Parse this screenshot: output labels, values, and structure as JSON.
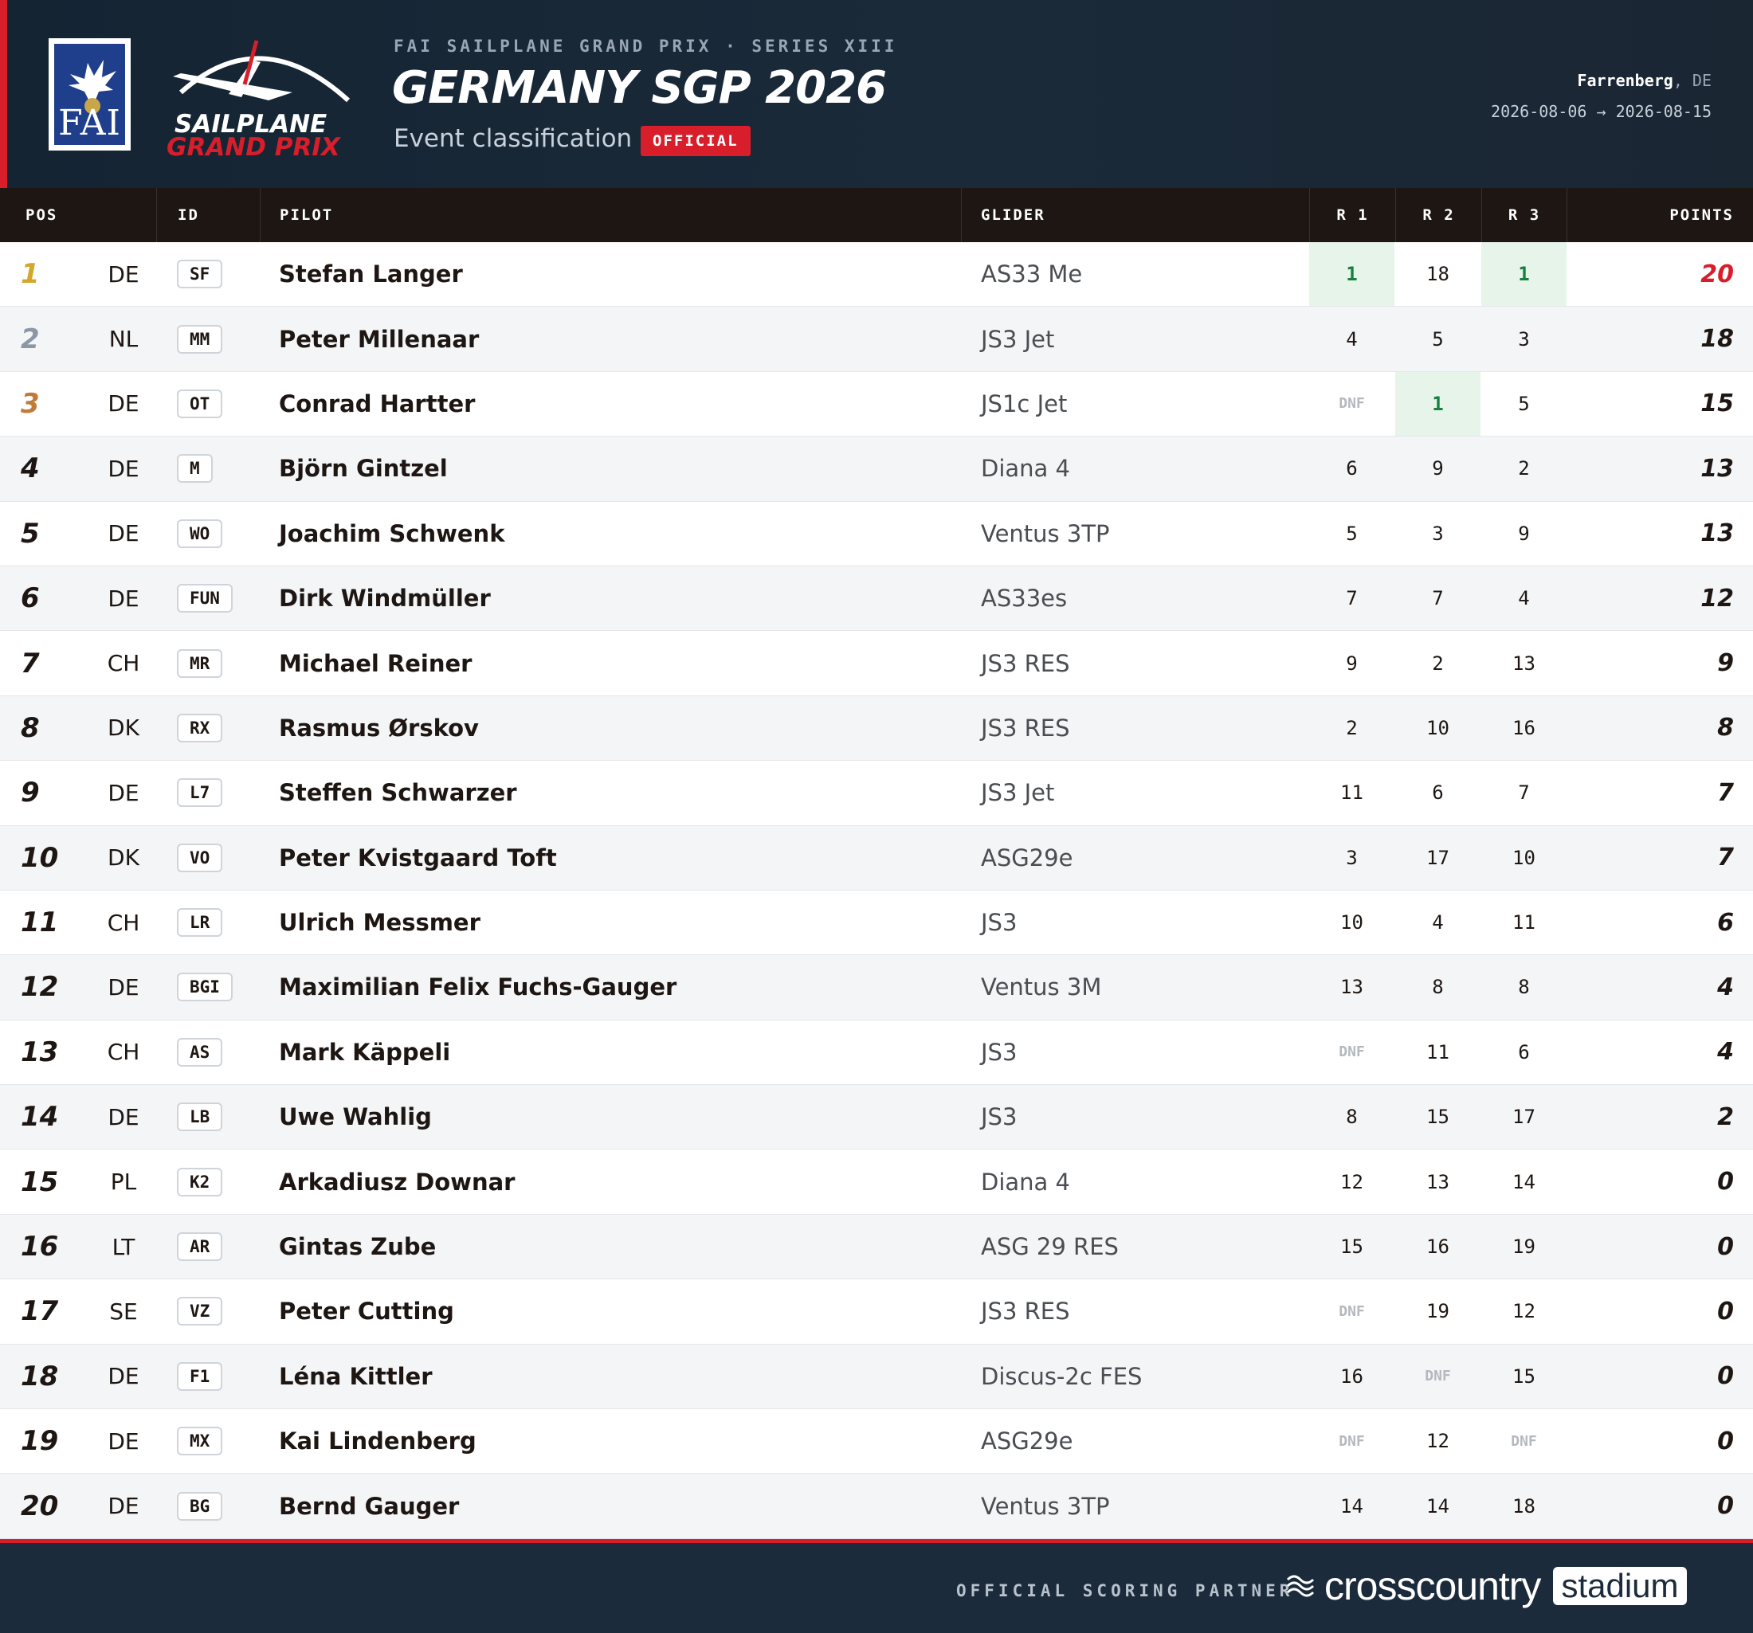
{
  "header": {
    "kicker": "FAI SAILPLANE GRAND PRIX · SERIES XIII",
    "title": "GERMANY SGP 2026",
    "subtitle": "Event classification",
    "badge": "OFFICIAL",
    "venue_city": "Farrenberg",
    "venue_country": ", DE",
    "dates": "2026-08-06 → 2026-08-15",
    "logo_fai_text": "FAI",
    "logo_sgp_line1": "SAILPLANE",
    "logo_sgp_line2": "GRAND PRIX"
  },
  "columns": {
    "pos": "POS",
    "id": "ID",
    "pilot": "PILOT",
    "glider": "GLIDER",
    "r1": "R 1",
    "r2": "R 2",
    "r3": "R 3",
    "points": "POINTS"
  },
  "colors": {
    "accent_red": "#d81e2a",
    "gold": "#d4a62a",
    "silver": "#8b97a6",
    "bronze": "#c07a3a",
    "win_bg": "#e6f4ea",
    "win_text": "#17803d"
  },
  "rows": [
    {
      "pos": "1",
      "nat": "DE",
      "id": "SF",
      "pilot": "Stefan Langer",
      "glider": "AS33 Me",
      "r1": "1",
      "r2": "18",
      "r3": "1",
      "points": "20"
    },
    {
      "pos": "2",
      "nat": "NL",
      "id": "MM",
      "pilot": "Peter Millenaar",
      "glider": "JS3 Jet",
      "r1": "4",
      "r2": "5",
      "r3": "3",
      "points": "18"
    },
    {
      "pos": "3",
      "nat": "DE",
      "id": "OT",
      "pilot": "Conrad Hartter",
      "glider": "JS1c Jet",
      "r1": "DNF",
      "r2": "1",
      "r3": "5",
      "points": "15"
    },
    {
      "pos": "4",
      "nat": "DE",
      "id": "M",
      "pilot": "Björn Gintzel",
      "glider": "Diana 4",
      "r1": "6",
      "r2": "9",
      "r3": "2",
      "points": "13"
    },
    {
      "pos": "5",
      "nat": "DE",
      "id": "WO",
      "pilot": "Joachim Schwenk",
      "glider": "Ventus 3TP",
      "r1": "5",
      "r2": "3",
      "r3": "9",
      "points": "13"
    },
    {
      "pos": "6",
      "nat": "DE",
      "id": "FUN",
      "pilot": "Dirk Windmüller",
      "glider": "AS33es",
      "r1": "7",
      "r2": "7",
      "r3": "4",
      "points": "12"
    },
    {
      "pos": "7",
      "nat": "CH",
      "id": "MR",
      "pilot": "Michael Reiner",
      "glider": "JS3 RES",
      "r1": "9",
      "r2": "2",
      "r3": "13",
      "points": "9"
    },
    {
      "pos": "8",
      "nat": "DK",
      "id": "RX",
      "pilot": "Rasmus Ørskov",
      "glider": "JS3 RES",
      "r1": "2",
      "r2": "10",
      "r3": "16",
      "points": "8"
    },
    {
      "pos": "9",
      "nat": "DE",
      "id": "L7",
      "pilot": "Steffen Schwarzer",
      "glider": "JS3 Jet",
      "r1": "11",
      "r2": "6",
      "r3": "7",
      "points": "7"
    },
    {
      "pos": "10",
      "nat": "DK",
      "id": "VO",
      "pilot": "Peter Kvistgaard Toft",
      "glider": "ASG29e",
      "r1": "3",
      "r2": "17",
      "r3": "10",
      "points": "7"
    },
    {
      "pos": "11",
      "nat": "CH",
      "id": "LR",
      "pilot": "Ulrich Messmer",
      "glider": "JS3",
      "r1": "10",
      "r2": "4",
      "r3": "11",
      "points": "6"
    },
    {
      "pos": "12",
      "nat": "DE",
      "id": "BGI",
      "pilot": "Maximilian Felix Fuchs-Gauger",
      "glider": "Ventus 3M",
      "r1": "13",
      "r2": "8",
      "r3": "8",
      "points": "4"
    },
    {
      "pos": "13",
      "nat": "CH",
      "id": "AS",
      "pilot": "Mark Käppeli",
      "glider": "JS3",
      "r1": "DNF",
      "r2": "11",
      "r3": "6",
      "points": "4"
    },
    {
      "pos": "14",
      "nat": "DE",
      "id": "LB",
      "pilot": "Uwe Wahlig",
      "glider": "JS3",
      "r1": "8",
      "r2": "15",
      "r3": "17",
      "points": "2"
    },
    {
      "pos": "15",
      "nat": "PL",
      "id": "K2",
      "pilot": "Arkadiusz Downar",
      "glider": "Diana 4",
      "r1": "12",
      "r2": "13",
      "r3": "14",
      "points": "0"
    },
    {
      "pos": "16",
      "nat": "LT",
      "id": "AR",
      "pilot": "Gintas Zube",
      "glider": "ASG 29 RES",
      "r1": "15",
      "r2": "16",
      "r3": "19",
      "points": "0"
    },
    {
      "pos": "17",
      "nat": "SE",
      "id": "VZ",
      "pilot": "Peter Cutting",
      "glider": "JS3 RES",
      "r1": "DNF",
      "r2": "19",
      "r3": "12",
      "points": "0"
    },
    {
      "pos": "18",
      "nat": "DE",
      "id": "F1",
      "pilot": "Léna Kittler",
      "glider": "Discus-2c FES",
      "r1": "16",
      "r2": "DNF",
      "r3": "15",
      "points": "0"
    },
    {
      "pos": "19",
      "nat": "DE",
      "id": "MX",
      "pilot": "Kai Lindenberg",
      "glider": "ASG29e",
      "r1": "DNF",
      "r2": "12",
      "r3": "DNF",
      "points": "0"
    },
    {
      "pos": "20",
      "nat": "DE",
      "id": "BG",
      "pilot": "Bernd Gauger",
      "glider": "Ventus 3TP",
      "r1": "14",
      "r2": "14",
      "r3": "18",
      "points": "0"
    }
  ],
  "footer": {
    "partner_label": "OFFICIAL SCORING PARTNER",
    "partner_name": "crosscountry",
    "partner_suffix": "stadium",
    "partner_icon": "wind-waves-icon"
  }
}
